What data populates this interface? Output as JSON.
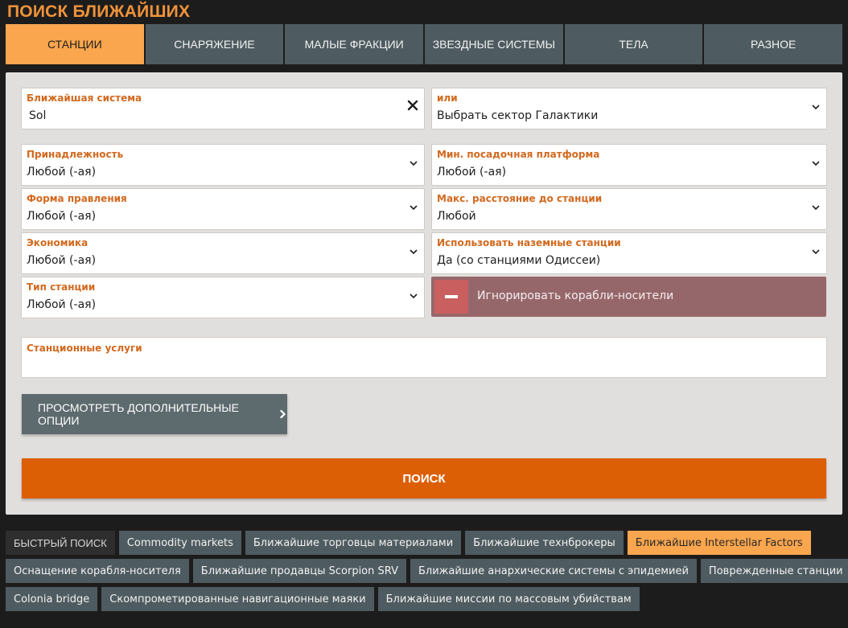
{
  "title": "ПОИСК БЛИЖАЙШИХ",
  "tabs": [
    {
      "label": "СТАНЦИИ",
      "active": true
    },
    {
      "label": "СНАРЯЖЕНИЕ"
    },
    {
      "label": "МАЛЫЕ ФРАКЦИИ"
    },
    {
      "label": "ЗВЕЗДНЫЕ СИСТЕМЫ"
    },
    {
      "label": "ТЕЛА"
    },
    {
      "label": "РАЗНОЕ"
    }
  ],
  "form": {
    "nearest_system": {
      "label": "Ближайшая система",
      "value": "Sol"
    },
    "or_sector": {
      "label": "или",
      "value": "Выбрать сектор Галактики"
    },
    "allegiance": {
      "label": "Принадлежность",
      "value": "Любой (-ая)"
    },
    "landing_pad": {
      "label": "Мин. посадочная платформа",
      "value": "Любой (-ая)"
    },
    "government": {
      "label": "Форма правления",
      "value": "Любой (-ая)"
    },
    "max_distance": {
      "label": "Макс. расстояние до станции",
      "value": "Любой"
    },
    "economy": {
      "label": "Экономика",
      "value": "Любой (-ая)"
    },
    "surface_stations": {
      "label": "Использовать наземные станции",
      "value": "Да (со станциями Одиссеи)"
    },
    "station_type": {
      "label": "Тип станции",
      "value": "Любой (-ая)"
    },
    "ignore_carriers": {
      "label": "Игнорировать корабли-носители"
    },
    "services": {
      "label": "Станционные услуги"
    }
  },
  "more_options_label": "ПРОСМОТРЕТЬ ДОПОЛНИТЕЛЬНЫЕ ОПЦИИ",
  "search_label": "ПОИСК",
  "quick": {
    "label": "БЫСТРЫЙ ПОИСК",
    "row1": [
      "Commodity markets",
      "Ближайшие торговцы материалами",
      "Ближайшие технброкеры",
      "Ближайшие Interstellar Factors"
    ],
    "row2": [
      "Оснащение корабля-носителя",
      "Ближайшие продавцы Scorpion SRV",
      "Ближайшие анархические системы с эпидемией",
      "Поврежденные станции"
    ],
    "row3": [
      "Colonia bridge",
      "Скомпрометированные навигационные маяки",
      "Ближайшие миссии по массовым убийствам"
    ]
  },
  "colors": {
    "accent": "#faa64e",
    "search": "#dc5f06",
    "tab": "#4e5b60",
    "label": "#d2691e"
  }
}
